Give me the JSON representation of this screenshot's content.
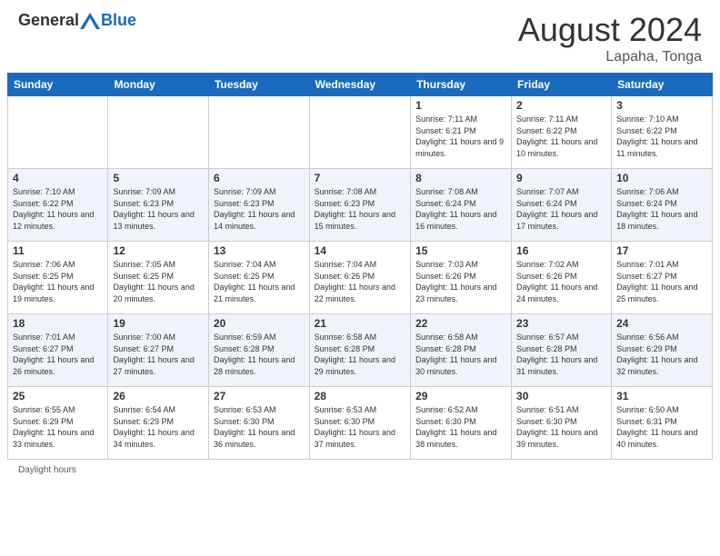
{
  "header": {
    "logo_general": "General",
    "logo_blue": "Blue",
    "month_year": "August 2024",
    "location": "Lapaha, Tonga"
  },
  "weekdays": [
    "Sunday",
    "Monday",
    "Tuesday",
    "Wednesday",
    "Thursday",
    "Friday",
    "Saturday"
  ],
  "footer": {
    "daylight_label": "Daylight hours"
  },
  "weeks": [
    [
      {
        "day": "",
        "sunrise": "",
        "sunset": "",
        "daylight": ""
      },
      {
        "day": "",
        "sunrise": "",
        "sunset": "",
        "daylight": ""
      },
      {
        "day": "",
        "sunrise": "",
        "sunset": "",
        "daylight": ""
      },
      {
        "day": "",
        "sunrise": "",
        "sunset": "",
        "daylight": ""
      },
      {
        "day": "1",
        "sunrise": "Sunrise: 7:11 AM",
        "sunset": "Sunset: 6:21 PM",
        "daylight": "Daylight: 11 hours and 9 minutes."
      },
      {
        "day": "2",
        "sunrise": "Sunrise: 7:11 AM",
        "sunset": "Sunset: 6:22 PM",
        "daylight": "Daylight: 11 hours and 10 minutes."
      },
      {
        "day": "3",
        "sunrise": "Sunrise: 7:10 AM",
        "sunset": "Sunset: 6:22 PM",
        "daylight": "Daylight: 11 hours and 11 minutes."
      }
    ],
    [
      {
        "day": "4",
        "sunrise": "Sunrise: 7:10 AM",
        "sunset": "Sunset: 6:22 PM",
        "daylight": "Daylight: 11 hours and 12 minutes."
      },
      {
        "day": "5",
        "sunrise": "Sunrise: 7:09 AM",
        "sunset": "Sunset: 6:23 PM",
        "daylight": "Daylight: 11 hours and 13 minutes."
      },
      {
        "day": "6",
        "sunrise": "Sunrise: 7:09 AM",
        "sunset": "Sunset: 6:23 PM",
        "daylight": "Daylight: 11 hours and 14 minutes."
      },
      {
        "day": "7",
        "sunrise": "Sunrise: 7:08 AM",
        "sunset": "Sunset: 6:23 PM",
        "daylight": "Daylight: 11 hours and 15 minutes."
      },
      {
        "day": "8",
        "sunrise": "Sunrise: 7:08 AM",
        "sunset": "Sunset: 6:24 PM",
        "daylight": "Daylight: 11 hours and 16 minutes."
      },
      {
        "day": "9",
        "sunrise": "Sunrise: 7:07 AM",
        "sunset": "Sunset: 6:24 PM",
        "daylight": "Daylight: 11 hours and 17 minutes."
      },
      {
        "day": "10",
        "sunrise": "Sunrise: 7:06 AM",
        "sunset": "Sunset: 6:24 PM",
        "daylight": "Daylight: 11 hours and 18 minutes."
      }
    ],
    [
      {
        "day": "11",
        "sunrise": "Sunrise: 7:06 AM",
        "sunset": "Sunset: 6:25 PM",
        "daylight": "Daylight: 11 hours and 19 minutes."
      },
      {
        "day": "12",
        "sunrise": "Sunrise: 7:05 AM",
        "sunset": "Sunset: 6:25 PM",
        "daylight": "Daylight: 11 hours and 20 minutes."
      },
      {
        "day": "13",
        "sunrise": "Sunrise: 7:04 AM",
        "sunset": "Sunset: 6:25 PM",
        "daylight": "Daylight: 11 hours and 21 minutes."
      },
      {
        "day": "14",
        "sunrise": "Sunrise: 7:04 AM",
        "sunset": "Sunset: 6:26 PM",
        "daylight": "Daylight: 11 hours and 22 minutes."
      },
      {
        "day": "15",
        "sunrise": "Sunrise: 7:03 AM",
        "sunset": "Sunset: 6:26 PM",
        "daylight": "Daylight: 11 hours and 23 minutes."
      },
      {
        "day": "16",
        "sunrise": "Sunrise: 7:02 AM",
        "sunset": "Sunset: 6:26 PM",
        "daylight": "Daylight: 11 hours and 24 minutes."
      },
      {
        "day": "17",
        "sunrise": "Sunrise: 7:01 AM",
        "sunset": "Sunset: 6:27 PM",
        "daylight": "Daylight: 11 hours and 25 minutes."
      }
    ],
    [
      {
        "day": "18",
        "sunrise": "Sunrise: 7:01 AM",
        "sunset": "Sunset: 6:27 PM",
        "daylight": "Daylight: 11 hours and 26 minutes."
      },
      {
        "day": "19",
        "sunrise": "Sunrise: 7:00 AM",
        "sunset": "Sunset: 6:27 PM",
        "daylight": "Daylight: 11 hours and 27 minutes."
      },
      {
        "day": "20",
        "sunrise": "Sunrise: 6:59 AM",
        "sunset": "Sunset: 6:28 PM",
        "daylight": "Daylight: 11 hours and 28 minutes."
      },
      {
        "day": "21",
        "sunrise": "Sunrise: 6:58 AM",
        "sunset": "Sunset: 6:28 PM",
        "daylight": "Daylight: 11 hours and 29 minutes."
      },
      {
        "day": "22",
        "sunrise": "Sunrise: 6:58 AM",
        "sunset": "Sunset: 6:28 PM",
        "daylight": "Daylight: 11 hours and 30 minutes."
      },
      {
        "day": "23",
        "sunrise": "Sunrise: 6:57 AM",
        "sunset": "Sunset: 6:28 PM",
        "daylight": "Daylight: 11 hours and 31 minutes."
      },
      {
        "day": "24",
        "sunrise": "Sunrise: 6:56 AM",
        "sunset": "Sunset: 6:29 PM",
        "daylight": "Daylight: 11 hours and 32 minutes."
      }
    ],
    [
      {
        "day": "25",
        "sunrise": "Sunrise: 6:55 AM",
        "sunset": "Sunset: 6:29 PM",
        "daylight": "Daylight: 11 hours and 33 minutes."
      },
      {
        "day": "26",
        "sunrise": "Sunrise: 6:54 AM",
        "sunset": "Sunset: 6:29 PM",
        "daylight": "Daylight: 11 hours and 34 minutes."
      },
      {
        "day": "27",
        "sunrise": "Sunrise: 6:53 AM",
        "sunset": "Sunset: 6:30 PM",
        "daylight": "Daylight: 11 hours and 36 minutes."
      },
      {
        "day": "28",
        "sunrise": "Sunrise: 6:53 AM",
        "sunset": "Sunset: 6:30 PM",
        "daylight": "Daylight: 11 hours and 37 minutes."
      },
      {
        "day": "29",
        "sunrise": "Sunrise: 6:52 AM",
        "sunset": "Sunset: 6:30 PM",
        "daylight": "Daylight: 11 hours and 38 minutes."
      },
      {
        "day": "30",
        "sunrise": "Sunrise: 6:51 AM",
        "sunset": "Sunset: 6:30 PM",
        "daylight": "Daylight: 11 hours and 39 minutes."
      },
      {
        "day": "31",
        "sunrise": "Sunrise: 6:50 AM",
        "sunset": "Sunset: 6:31 PM",
        "daylight": "Daylight: 11 hours and 40 minutes."
      }
    ]
  ]
}
